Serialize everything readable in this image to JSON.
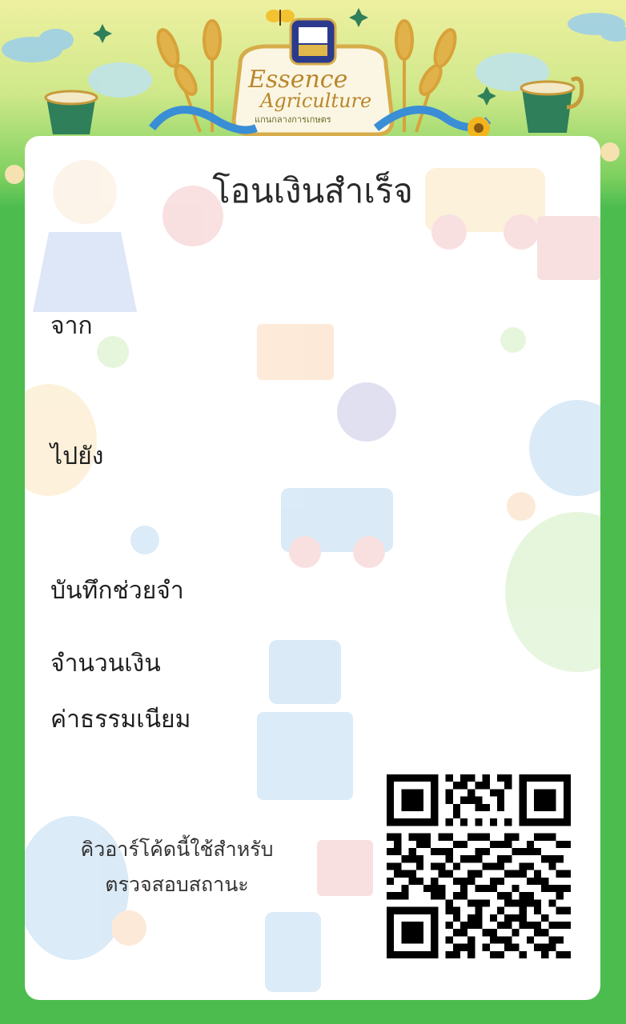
{
  "banner": {
    "logo_line1": "Essence",
    "logo_line2": "Agriculture",
    "logo_subtitle": "แกนกลางการเกษตร"
  },
  "receipt": {
    "title": "โอนเงินสำเร็จ",
    "from_label": "จาก",
    "to_label": "ไปยัง",
    "memo_label": "บันทึกช่วยจำ",
    "amount_label": "จำนวนเงิน",
    "fee_label": "ค่าธรรมเนียม"
  },
  "qr": {
    "note_line1": "คิวอาร์โค้ดนี้ใช้สำหรับ",
    "note_line2": "ตรวจสอบสถานะ"
  },
  "colors": {
    "frame_green": "#4cbc4f",
    "banner_yellow": "#eef0a0",
    "gold": "#b9862c",
    "text": "#1f1f1f"
  }
}
